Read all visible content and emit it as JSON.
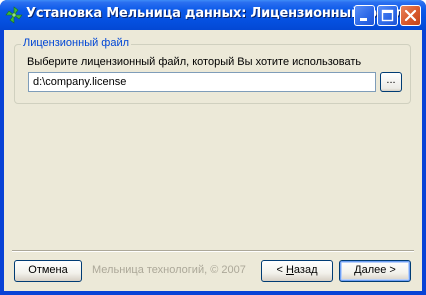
{
  "window": {
    "title": "Установка Мельница данных: Лицензионный файл",
    "icon": "mill-app-icon"
  },
  "titlebar_buttons": {
    "minimize": "minimize-icon",
    "maximize": "maximize-icon",
    "close": "close-icon"
  },
  "license_group": {
    "title": "Лицензионный файл",
    "prompt": "Выберите лицензионный файл, который Вы хотите использовать",
    "path_value": "d:\\company.license",
    "browse_label": "..."
  },
  "footer": {
    "cancel_label": "Отмена",
    "copyright": "Мельница технологий, © 2007",
    "back_hotkey": "Н",
    "back_rest": "азад",
    "back_prefix": "< ",
    "next_hotkey": "Д",
    "next_rest": "алее >"
  },
  "colors": {
    "title_bar": "#0a58e8",
    "client_bg": "#ece9d8",
    "group_title": "#0046d5",
    "close_button": "#d8592c"
  }
}
